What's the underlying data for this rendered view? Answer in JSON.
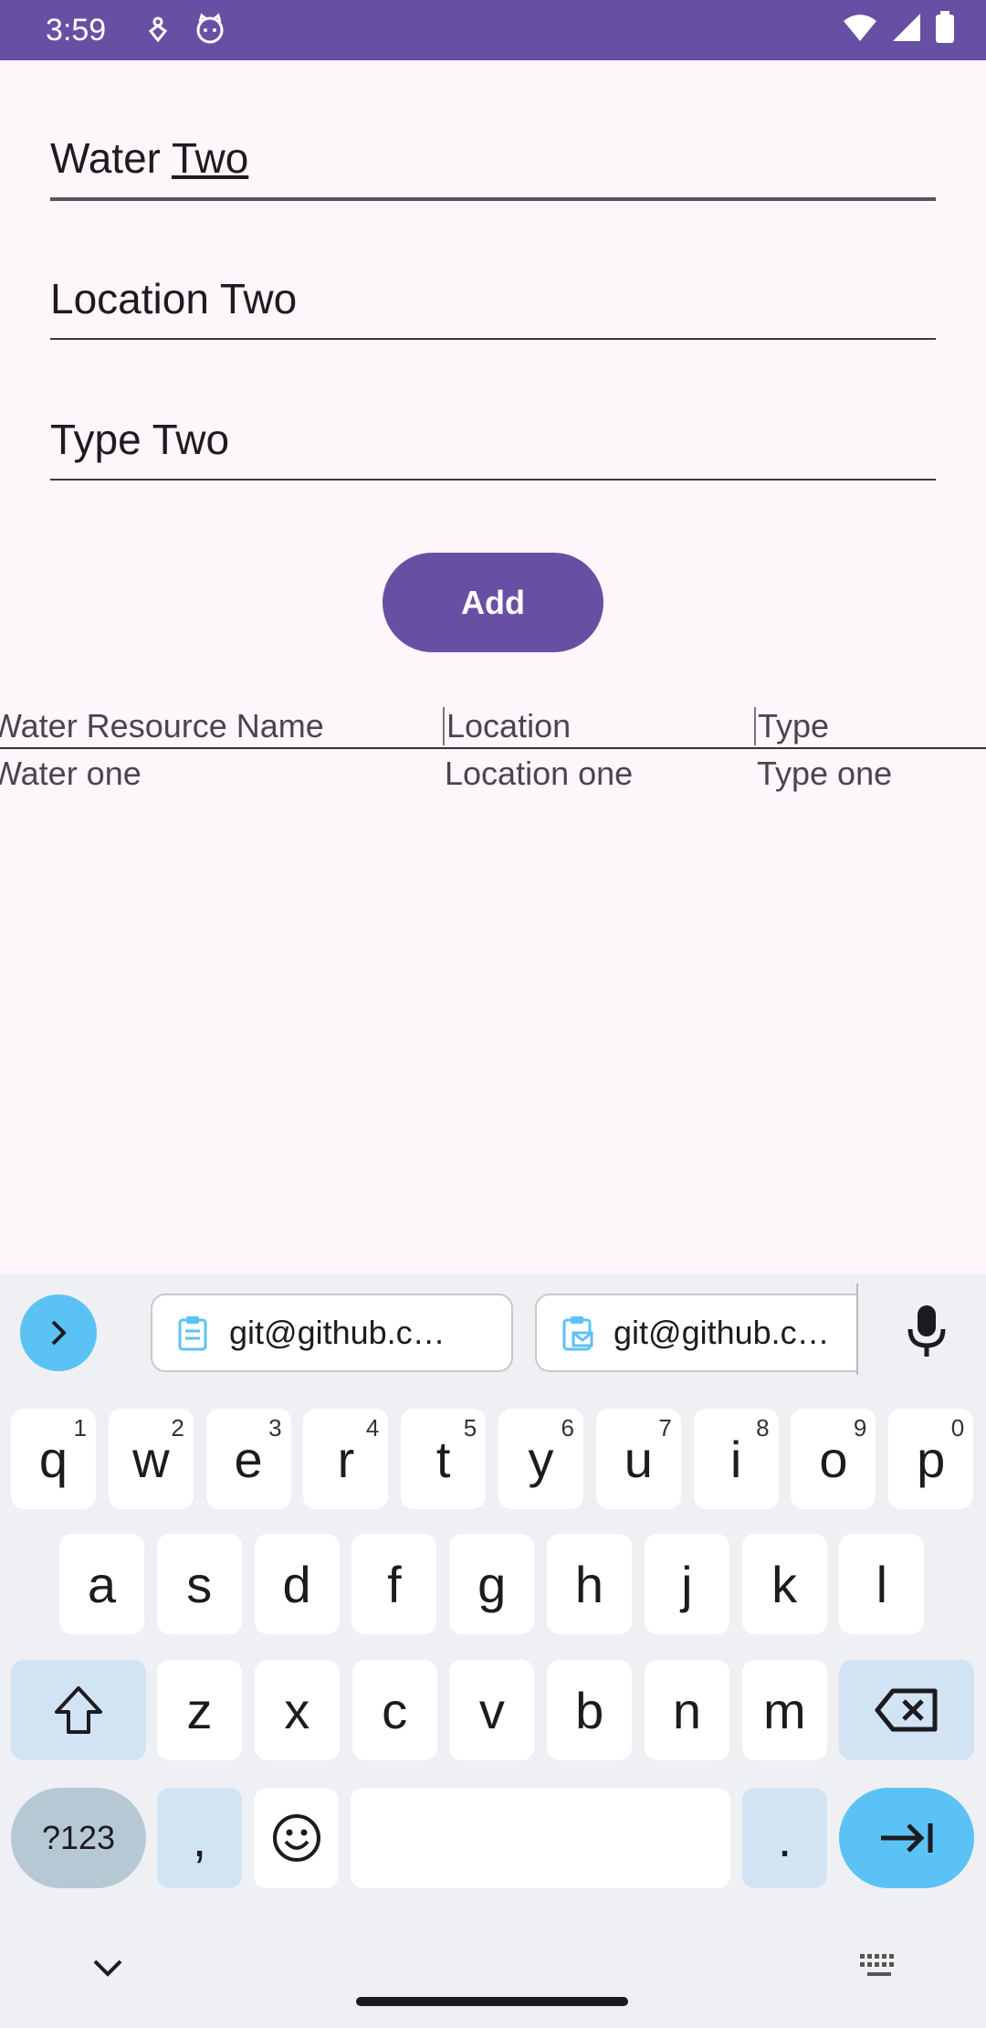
{
  "status_bar": {
    "time": "3:59",
    "icons_left": [
      "usb-debug-icon",
      "cat-face-icon"
    ],
    "icons_right": [
      "wifi-icon",
      "signal-icon",
      "battery-icon"
    ],
    "color": "#6750a4"
  },
  "form": {
    "water_name": {
      "value_first": "Water",
      "value_second": "Two"
    },
    "location": {
      "value": "Location Two"
    },
    "type": {
      "value": "Type Two"
    },
    "add_label": "Add"
  },
  "table": {
    "headers": [
      "Water Resource Name",
      "Location",
      "Type"
    ],
    "rows": [
      [
        "Water one",
        "Location one",
        "Type one"
      ]
    ]
  },
  "keyboard": {
    "suggestions": [
      "git@github.c…",
      "git@github.c…"
    ],
    "row1": [
      {
        "k": "q",
        "n": "1"
      },
      {
        "k": "w",
        "n": "2"
      },
      {
        "k": "e",
        "n": "3"
      },
      {
        "k": "r",
        "n": "4"
      },
      {
        "k": "t",
        "n": "5"
      },
      {
        "k": "y",
        "n": "6"
      },
      {
        "k": "u",
        "n": "7"
      },
      {
        "k": "i",
        "n": "8"
      },
      {
        "k": "o",
        "n": "9"
      },
      {
        "k": "p",
        "n": "0"
      }
    ],
    "row2": [
      "a",
      "s",
      "d",
      "f",
      "g",
      "h",
      "j",
      "k",
      "l"
    ],
    "row3": [
      "z",
      "x",
      "c",
      "v",
      "b",
      "n",
      "m"
    ],
    "sym_label": "?123",
    "comma": ",",
    "period": ".",
    "accent_color": "#5bc2f5"
  }
}
